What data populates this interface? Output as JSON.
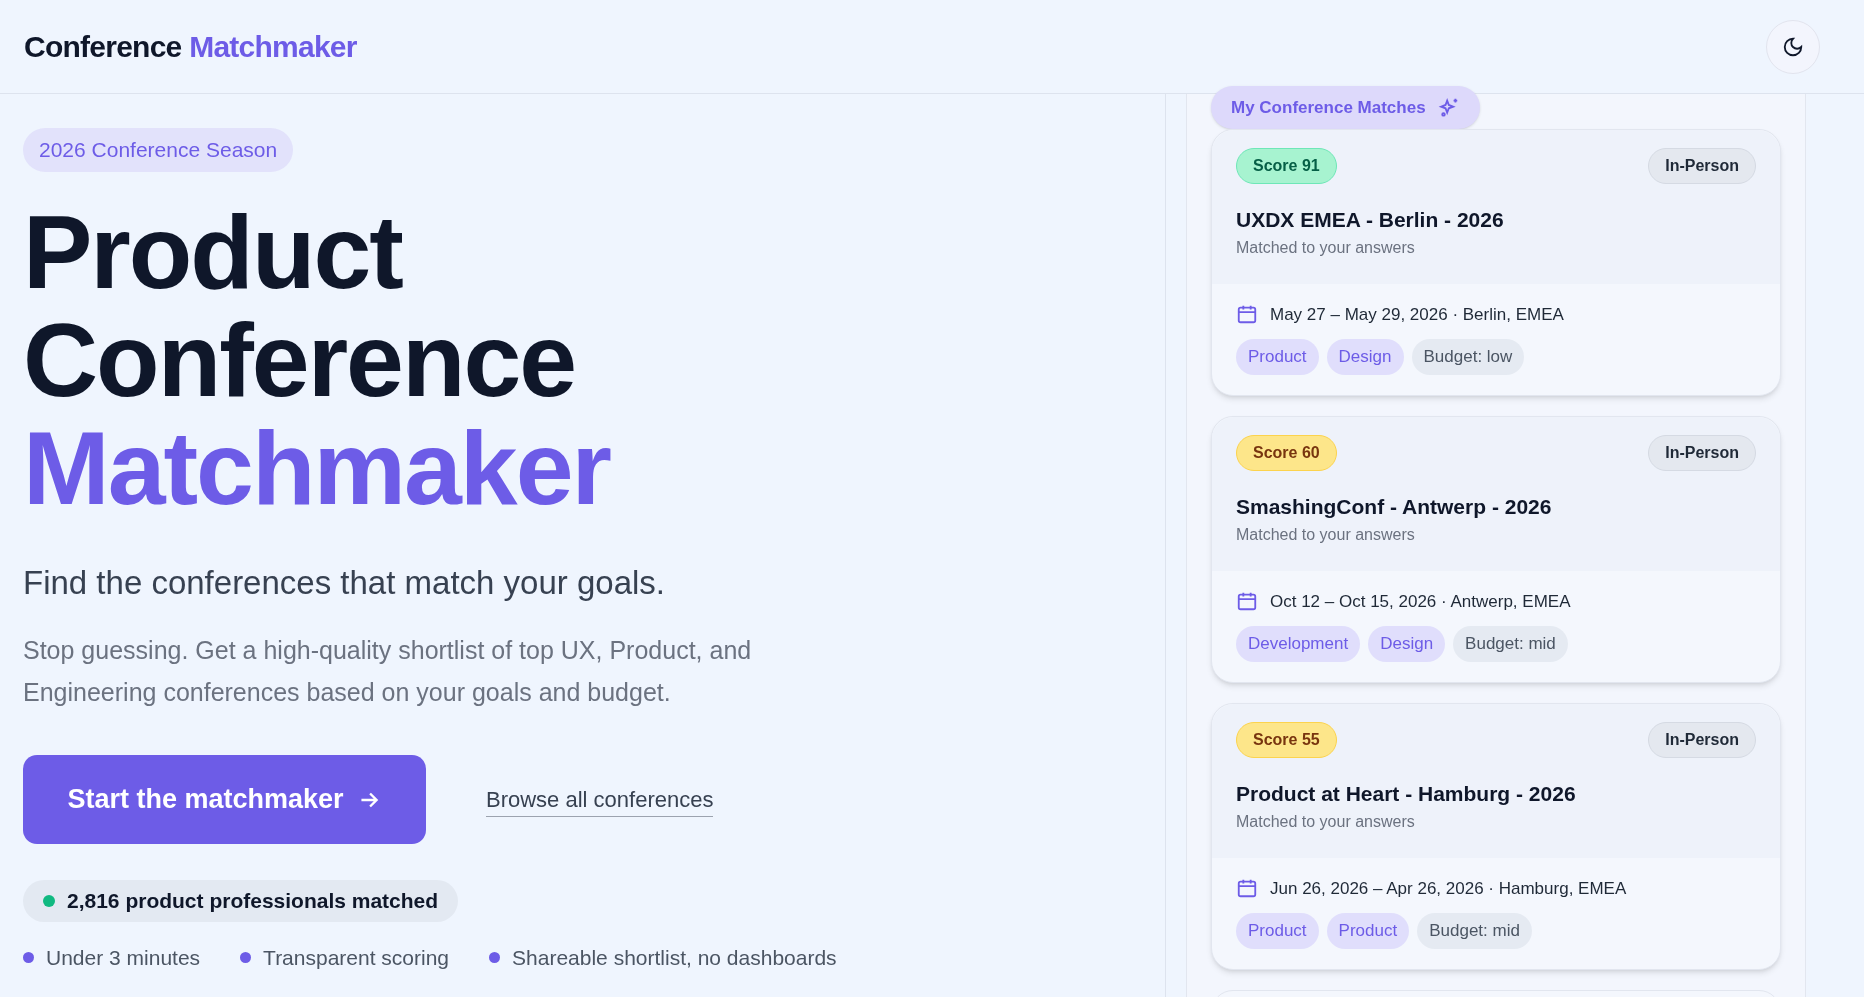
{
  "header": {
    "brand": "Conference",
    "brand_accent": "Matchmaker"
  },
  "hero": {
    "badge": "2026 Conference Season",
    "title_lines": [
      "Product",
      "Conference"
    ],
    "title_accent": "Matchmaker",
    "subtitle": "Find the conferences that match your goals.",
    "body": "Stop guessing. Get a high-quality shortlist of top UX, Product, and Engineering conferences based on your goals and budget.",
    "primary_button": "Start the matchmaker",
    "secondary_link": "Browse all conferences",
    "stat": "2,816 product professionals matched",
    "bullets": [
      "Under 3 minutes",
      "Transparent scoring",
      "Shareable shortlist, no dashboards"
    ]
  },
  "matches": {
    "title": "My Conference Matches",
    "cards": [
      {
        "score": "Score 91",
        "color": "#a7f3d0",
        "format": "In-Person",
        "name": "UXDX EMEA - Berlin - 2026",
        "note": "Matched to your answers",
        "when": "May 27 – May 29, 2026 · Berlin, EMEA",
        "tags": [
          {
            "kind": "topic",
            "label": "Product"
          },
          {
            "kind": "topic",
            "label": "Design"
          },
          {
            "kind": "budget",
            "label": "Budget: low"
          }
        ]
      },
      {
        "score": "Score 60",
        "color": "#fde68a",
        "format": "In-Person",
        "name": "SmashingConf - Antwerp - 2026",
        "note": "Matched to your answers",
        "when": "Oct 12 – Oct 15, 2026 · Antwerp, EMEA",
        "tags": [
          {
            "kind": "topic",
            "label": "Development"
          },
          {
            "kind": "topic",
            "label": "Design"
          },
          {
            "kind": "budget",
            "label": "Budget: mid"
          }
        ]
      },
      {
        "score": "Score 55",
        "color": "#fde68a",
        "format": "In-Person",
        "name": "Product at Heart - Hamburg - 2026",
        "note": "Matched to your answers",
        "when": "Jun 26, 2026 – Apr 26, 2026 · Hamburg, EMEA",
        "tags": [
          {
            "kind": "topic",
            "label": "Product"
          },
          {
            "kind": "topic",
            "label": "Product"
          },
          {
            "kind": "budget",
            "label": "Budget: mid"
          }
        ]
      }
    ]
  }
}
